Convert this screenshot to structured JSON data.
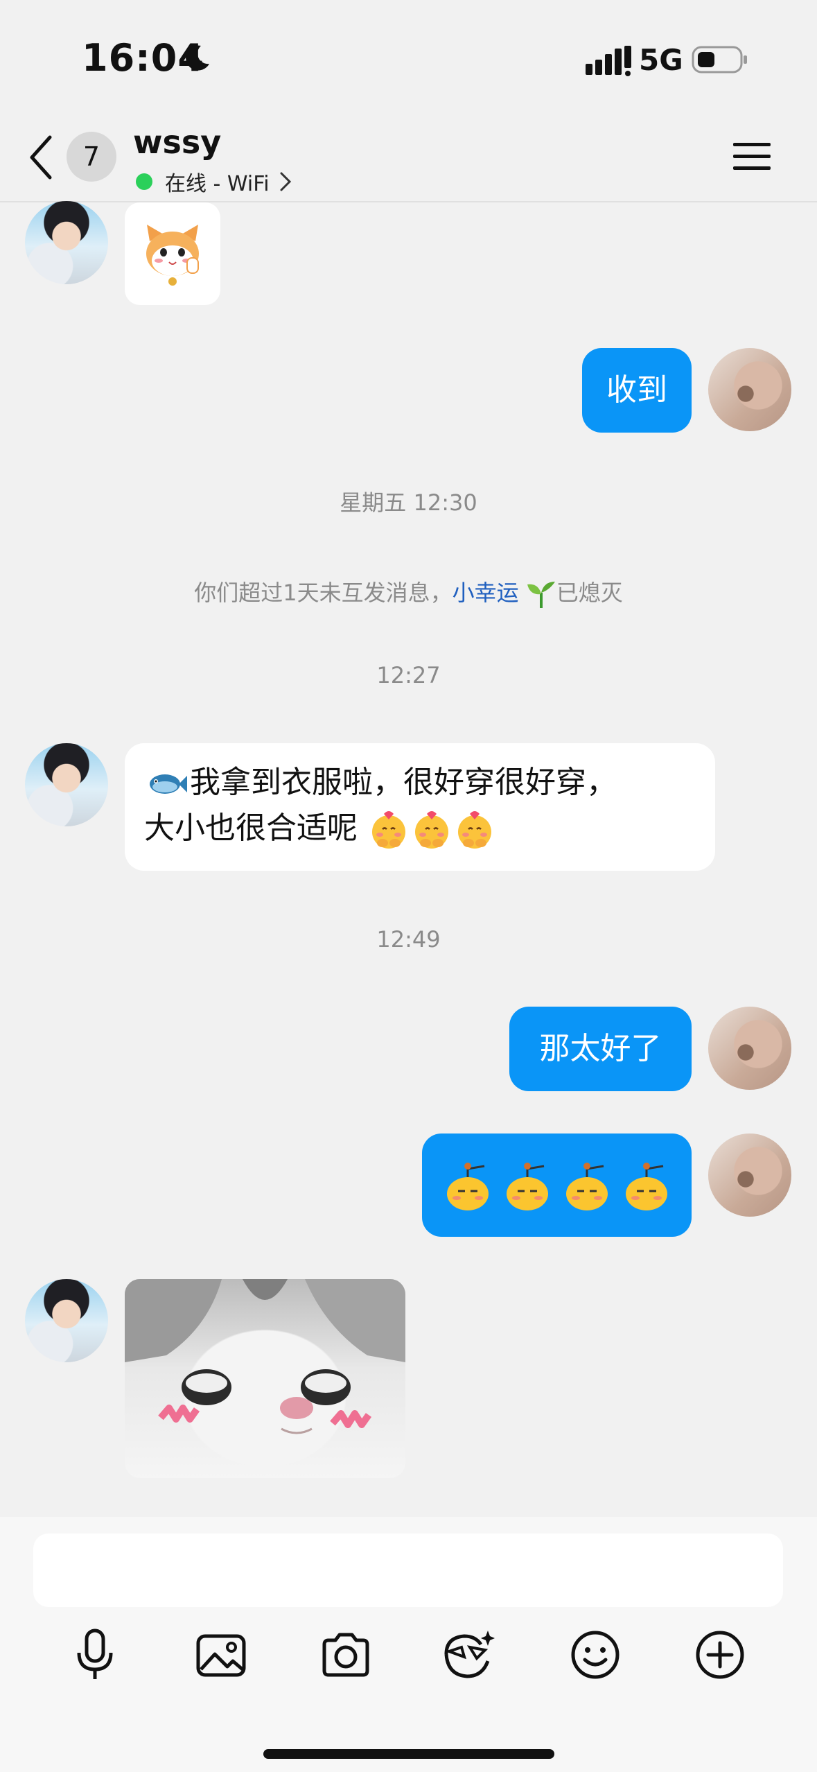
{
  "status_bar": {
    "time": "16:04",
    "network": "5G",
    "icons": [
      "moon-icon",
      "signal-icon",
      "battery-icon"
    ]
  },
  "header": {
    "unread_count": "7",
    "contact_name": "wssy",
    "online_status": "在线 - WiFi",
    "icons": [
      "back-chevron-icon",
      "menu-icon",
      "chevron-right-icon"
    ]
  },
  "messages": [
    {
      "from": "them",
      "kind": "sticker",
      "sticker": "cat-face-sticker"
    },
    {
      "from": "me",
      "kind": "text",
      "text": "收到"
    },
    {
      "kind": "timestamp",
      "text": "星期五 12:30"
    },
    {
      "kind": "notice",
      "prefix": "你们超过1天未互发消息，",
      "link": "小幸运",
      "suffix": "已熄灭"
    },
    {
      "kind": "timestamp",
      "text": "12:27"
    },
    {
      "from": "them",
      "kind": "text",
      "line1": "我拿到衣服啦，很好穿很好穿，",
      "line2": "大小也很合适呢"
    },
    {
      "kind": "timestamp",
      "text": "12:49"
    },
    {
      "from": "me",
      "kind": "text",
      "text": "那太好了"
    },
    {
      "from": "me",
      "kind": "emoji-row",
      "emoji": "yellow-face-sprout-emoji",
      "count": 4
    },
    {
      "from": "them",
      "kind": "image",
      "image": "cat-photo"
    }
  ],
  "colors": {
    "sent_bubble": "#0a95f7",
    "received_bubble": "#ffffff",
    "background": "#f1f1f1",
    "online_dot": "#2bd05a",
    "link": "#1f5fbf"
  },
  "composer": {
    "input_value": "",
    "tools": [
      "microphone-icon",
      "image-icon",
      "camera-icon",
      "face-sticker-icon",
      "emoji-smile-icon",
      "plus-icon"
    ]
  }
}
